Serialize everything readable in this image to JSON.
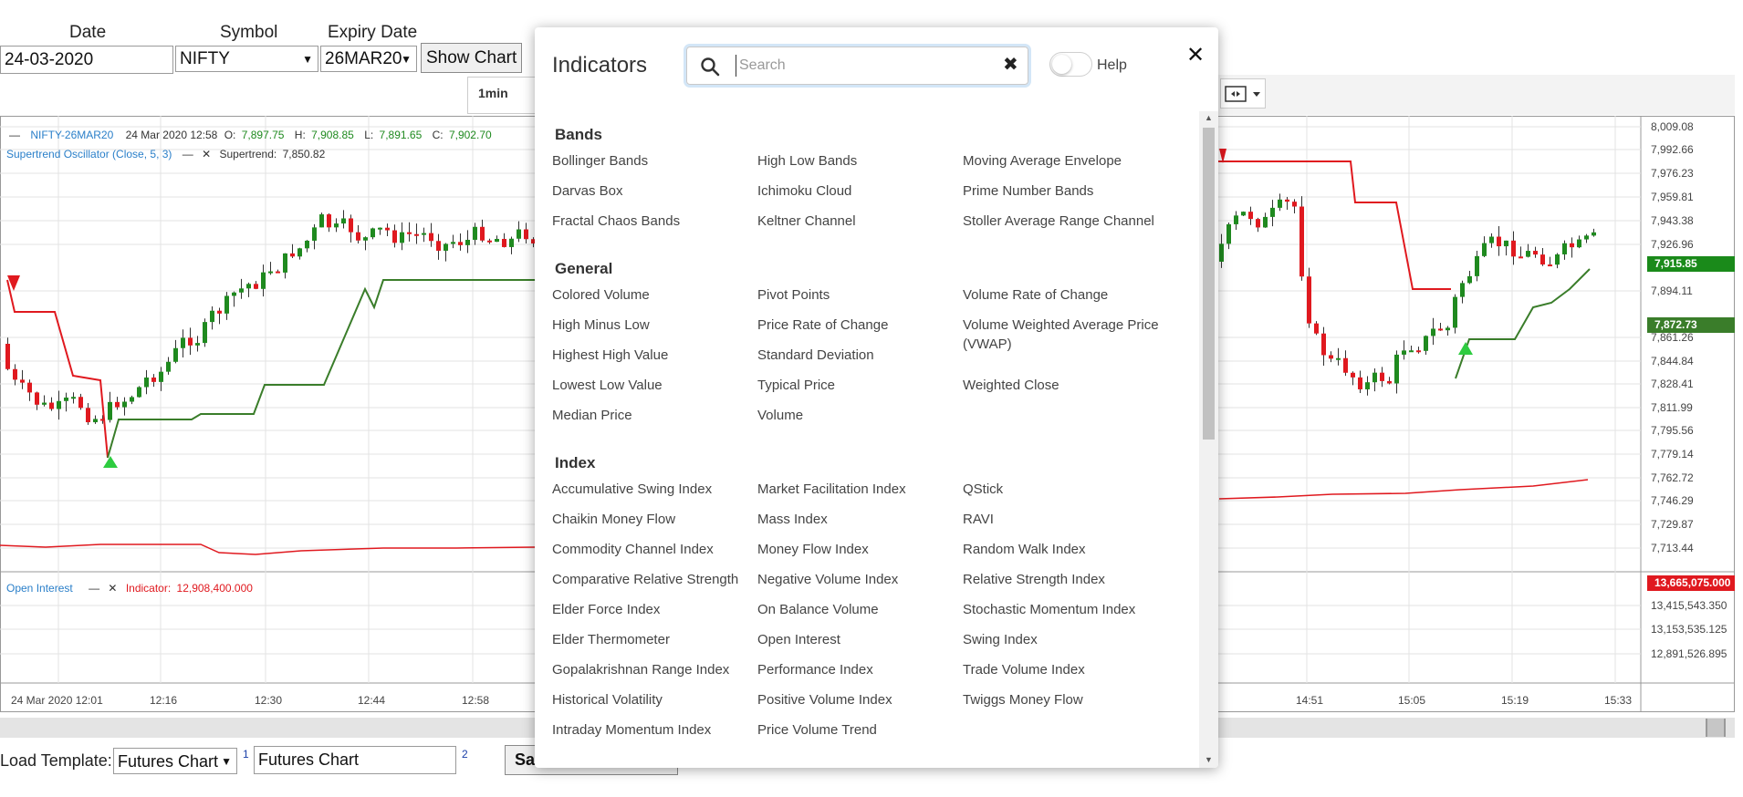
{
  "form": {
    "date_label": "Date",
    "date_value": "24-03-2020",
    "symbol_label": "Symbol",
    "symbol_value": "NIFTY",
    "expiry_label": "Expiry Date",
    "expiry_value": "26MAR20",
    "show_chart_label": "Show Chart"
  },
  "toolbar": {
    "interval_label": "1min"
  },
  "chart": {
    "instrument": "NIFTY-26MAR20",
    "bar_time": "24 Mar 2020 12:58",
    "o_label": "O:",
    "o_value": "7,897.75",
    "h_label": "H:",
    "h_value": "7,908.85",
    "l_label": "L:",
    "l_value": "7,891.65",
    "c_label": "C:",
    "c_value": "7,902.70",
    "study_label": "Supertrend Oscillator (Close, 5, 3)",
    "study_value_label": "Supertrend:",
    "study_value": "7,850.82",
    "oi_label": "Open Interest",
    "oi_value_label": "Indicator:",
    "oi_value": "12,908,400.000",
    "price_axis": [
      "8,009.08",
      "7,992.66",
      "7,976.23",
      "7,959.81",
      "7,943.38",
      "7,926.96",
      "7,894.11",
      "7,861.26",
      "7,844.84",
      "7,828.41",
      "7,811.99",
      "7,795.56",
      "7,779.14",
      "7,762.72",
      "7,746.29",
      "7,729.87",
      "7,713.44"
    ],
    "price_tag_1": "7,915.85",
    "price_tag_2": "7,872.73",
    "oi_axis": [
      "13,415,543.350",
      "13,153,535.125",
      "12,891,526.895"
    ],
    "oi_tag": "13,665,075.000",
    "time_axis_left": [
      "24 Mar 2020 12:01",
      "12:16",
      "12:30",
      "12:44",
      "12:58"
    ],
    "time_axis_right": [
      "14:51",
      "15:05",
      "15:19",
      "15:33"
    ],
    "colors": {
      "up": "#1f8a1f",
      "down": "#e0191f",
      "supertrend_up": "#3a7d2a",
      "supertrend_down": "#e0191f",
      "grid": "#e3e3e3"
    }
  },
  "footer": {
    "load_template_label": "Load Template:",
    "template_value": "Futures Chart",
    "sup1": "1",
    "template_name_value": "Futures Chart",
    "sup2": "2",
    "save_label": "Sa"
  },
  "modal": {
    "title": "Indicators",
    "search_placeholder": "Search",
    "help_label": "Help",
    "sections": [
      {
        "name": "Bands",
        "items": [
          "Bollinger Bands",
          "High Low Bands",
          "Moving Average Envelope",
          "Darvas Box",
          "Ichimoku Cloud",
          "Prime Number Bands",
          "Fractal Chaos Bands",
          "Keltner Channel",
          "Stoller Average Range Channel"
        ]
      },
      {
        "name": "General",
        "items": [
          "Colored Volume",
          "Pivot Points",
          "Volume Rate of Change",
          "High Minus Low",
          "Price Rate of Change",
          "Volume Weighted Average Price (VWAP)",
          "Highest High Value",
          "Standard Deviation",
          "",
          "Lowest Low Value",
          "Typical Price",
          "Weighted Close",
          "Median Price",
          "Volume",
          ""
        ]
      },
      {
        "name": "Index",
        "items": [
          "Accumulative Swing Index",
          "Market Facilitation Index",
          "QStick",
          "Chaikin Money Flow",
          "Mass Index",
          "RAVI",
          "Commodity Channel Index",
          "Money Flow Index",
          "Random Walk Index",
          "Comparative Relative Strength",
          "Negative Volume Index",
          "Relative Strength Index",
          "Elder Force Index",
          "On Balance Volume",
          "Stochastic Momentum Index",
          "Elder Thermometer",
          "Open Interest",
          "Swing Index",
          "Gopalakrishnan Range Index",
          "Performance Index",
          "Trade Volume Index",
          "Historical Volatility",
          "Positive Volume Index",
          "Twiggs Money Flow",
          "Intraday Momentum Index",
          "Price Volume Trend",
          ""
        ]
      }
    ],
    "icons": {
      "search": "search-icon",
      "clear": "clear-search-icon",
      "close": "close-icon"
    }
  }
}
